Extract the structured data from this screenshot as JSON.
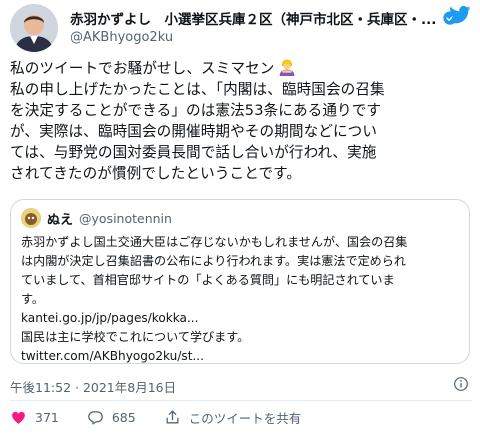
{
  "author": {
    "display_name": "赤羽かずよし　小選挙区兵庫２区（神戸市北区・兵庫区・...",
    "handle": "@AKBhyogo2ku",
    "avatar_icon": "profile-photo-icon",
    "verified_icon": "verified-badge-icon"
  },
  "tweet": {
    "lines": [
      "私のツイートでお騒がせし、スミマセン",
      "私の申し上げたかったことは、「内閣は、臨時国会の召集",
      "を決定することができる」のは憲法53条にある通りです",
      "が、実際は、臨時国会の開催時期やその期間などについ",
      "ては、与野党の国対委員長間で話し合いが行われ、実施",
      "されてきたのが慣例でしたということです。"
    ],
    "emoji_icon": "person-bowing-emoji"
  },
  "quote": {
    "name": "ぬえ",
    "handle": "@yosinotennin",
    "lines": [
      "赤羽かずよし国土交通大臣はご存じないかもしれませんが、国会の召集",
      "は内閣が決定し召集詔書の公布により行われます。実は憲法で定められ",
      "ていまして、首相官邸サイトの「よくある質問」にも明記されていま",
      "す。",
      "kantei.go.jp/jp/pages/kokka...",
      "国民は主に学校でこれについて学びます。",
      "twitter.com/AKBhyogo2ku/st..."
    ]
  },
  "meta": {
    "timestamp": "午後11:52 · 2021年8月16日"
  },
  "actions": {
    "like_count": "371",
    "reply_count": "685",
    "share_label": "このツイートを共有"
  },
  "colors": {
    "accent": "#1d9bf0",
    "like": "#f91880",
    "text": "#0f1419",
    "secondary": "#536471"
  }
}
